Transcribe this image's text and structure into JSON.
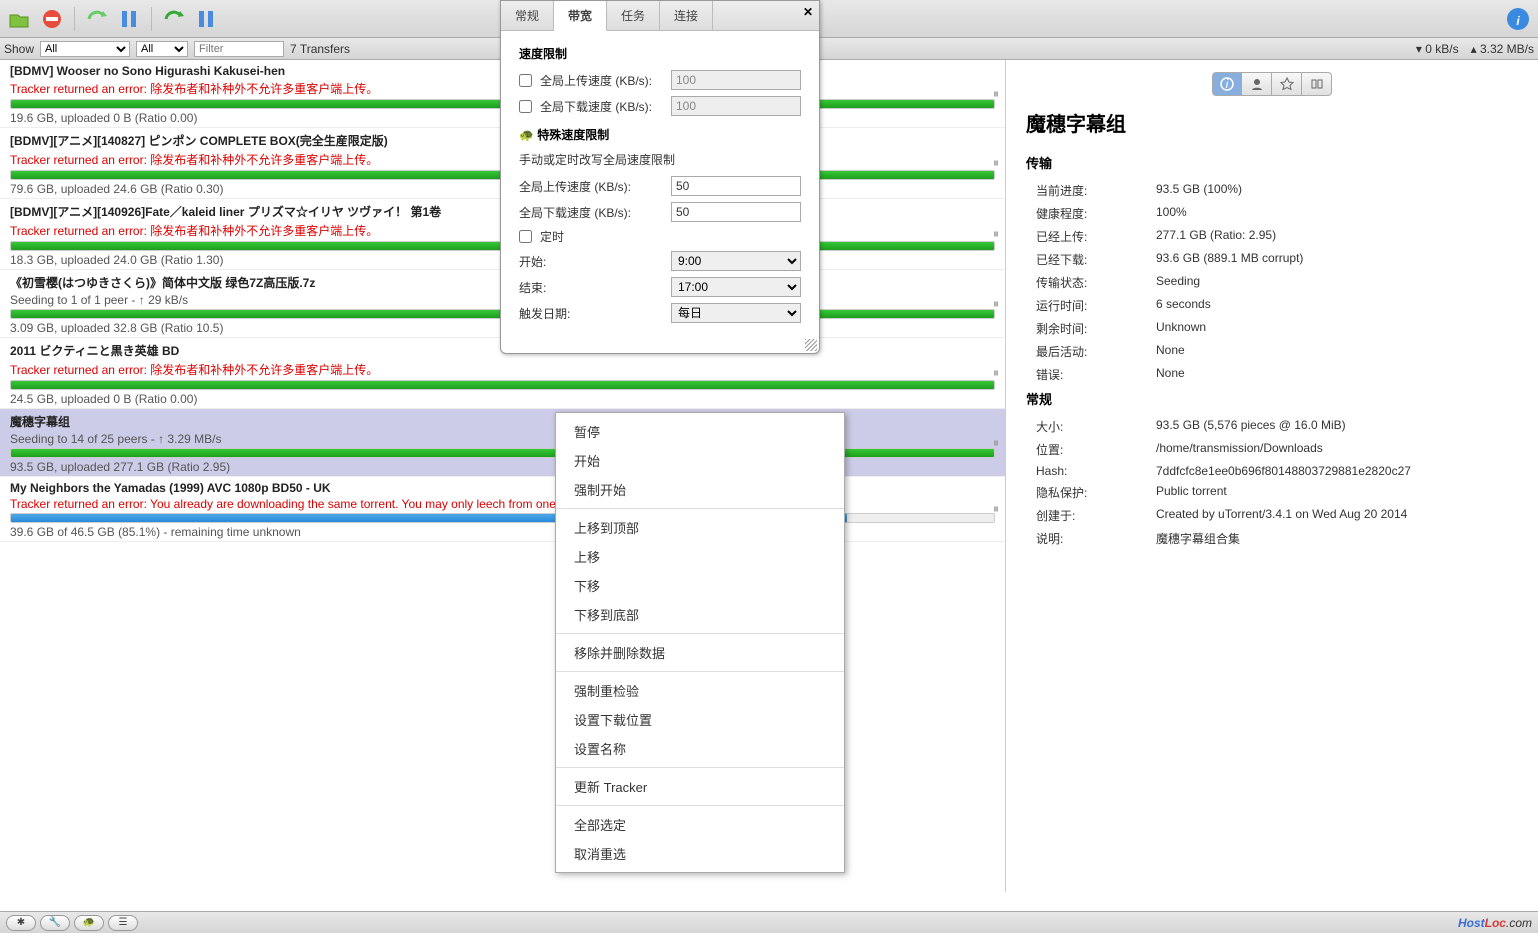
{
  "toolbar": {},
  "filter": {
    "show_label": "Show",
    "all1": "All",
    "all2": "All",
    "filter_placeholder": "Filter",
    "count": "7 Transfers",
    "down": "0 kB/s",
    "up": "3.32 MB/s"
  },
  "torrents": [
    {
      "title": "[BDMV] Wooser no Sono Higurashi Kakusei-hen",
      "err": "Tracker returned an error: 除发布者和补种外不允许多重客户端上传。",
      "pct": 100,
      "color": "green",
      "foot": "19.6 GB, uploaded 0 B (Ratio 0.00)",
      "status": ""
    },
    {
      "title": "[BDMV][アニメ][140827] ピンポン COMPLETE BOX(完全生産限定版)",
      "err": "Tracker returned an error: 除发布者和补种外不允许多重客户端上传。",
      "pct": 100,
      "color": "green",
      "foot": "79.6 GB, uploaded 24.6 GB (Ratio 0.30)",
      "status": ""
    },
    {
      "title": "[BDMV][アニメ][140926]Fate／kaleid liner プリズマ☆イリヤ ツヴァイ！ 第1卷",
      "err": "Tracker returned an error: 除发布者和补种外不允许多重客户端上传。",
      "pct": 100,
      "color": "green",
      "foot": "18.3 GB, uploaded 24.0 GB (Ratio 1.30)",
      "status": ""
    },
    {
      "title": "《初雪樱(はつゆきさくら)》简体中文版 绿色7Z高压版.7z",
      "err": "",
      "status": "Seeding to 1 of 1 peer - ↑ 29 kB/s",
      "pct": 100,
      "color": "green",
      "foot": "3.09 GB, uploaded 32.8 GB (Ratio 10.5)"
    },
    {
      "title": "2011 ビクティニと黒き英雄 BD",
      "err": "Tracker returned an error: 除发布者和补种外不允许多重客户端上传。",
      "pct": 100,
      "color": "green",
      "foot": "24.5 GB, uploaded 0 B (Ratio 0.00)",
      "status": ""
    },
    {
      "title": "魔穗字幕组",
      "err": "",
      "status": "Seeding to 14 of 25 peers - ↑ 3.29 MB/s",
      "pct": 100,
      "color": "green",
      "foot": "93.5 GB, uploaded 277.1 GB (Ratio 2.95)",
      "selected": true
    },
    {
      "title": "My Neighbors the Yamadas (1999) AVC 1080p BD50 - UK",
      "err": "Tracker returned an error: You already are downloading the same torrent. You may only leech from one location at a time.",
      "pct": 85,
      "color": "blue",
      "foot": "39.6 GB of 46.5 GB (85.1%) - remaining time unknown",
      "status": ""
    }
  ],
  "sidebar": {
    "title": "魔穗字幕组",
    "sections": {
      "transfer_label": "传输",
      "general_label": "常规"
    },
    "transfer": {
      "progress_k": "当前进度:",
      "progress_v": "93.5 GB (100%)",
      "health_k": "健康程度:",
      "health_v": "100%",
      "uploaded_k": "已经上传:",
      "uploaded_v": "277.1 GB (Ratio: 2.95)",
      "downloaded_k": "已经下载:",
      "downloaded_v": "93.6 GB (889.1 MB corrupt)",
      "state_k": "传输状态:",
      "state_v": "Seeding",
      "runtime_k": "运行时间:",
      "runtime_v": "6 seconds",
      "remain_k": "剩余时间:",
      "remain_v": "Unknown",
      "last_k": "最后活动:",
      "last_v": "None",
      "error_k": "错误:",
      "error_v": "None"
    },
    "general": {
      "size_k": "大小:",
      "size_v": "93.5 GB (5,576 pieces @ 16.0 MiB)",
      "loc_k": "位置:",
      "loc_v": "/home/transmission/Downloads",
      "hash_k": "Hash:",
      "hash_v": "7ddfcfc8e1ee0b696f80148803729881e2820c27",
      "priv_k": "隐私保护:",
      "priv_v": "Public torrent",
      "created_k": "创建于:",
      "created_v": "Created by uTorrent/3.4.1 on Wed Aug 20 2014",
      "desc_k": "说明:",
      "desc_v": "魔穗字幕组合集"
    }
  },
  "dialog": {
    "tabs": {
      "general": "常规",
      "bw": "带宽",
      "task": "任务",
      "conn": "连接"
    },
    "h1": "速度限制",
    "gup_label": "全局上传速度 (KB/s):",
    "gup_val": "100",
    "gdown_label": "全局下载速度 (KB/s):",
    "gdown_val": "100",
    "h2": "特殊速度限制",
    "sub": "手动或定时改写全局速度限制",
    "sup_label": "全局上传速度 (KB/s):",
    "sup_val": "50",
    "sdown_label": "全局下载速度 (KB/s):",
    "sdown_val": "50",
    "sched_label": "定时",
    "start_label": "开始:",
    "start_val": "9:00",
    "end_label": "结束:",
    "end_val": "17:00",
    "trig_label": "触发日期:",
    "trig_val": "每日"
  },
  "context": {
    "items1": [
      "暂停",
      "开始",
      "强制开始"
    ],
    "items2": [
      "上移到顶部",
      "上移",
      "下移",
      "下移到底部"
    ],
    "items3": [
      "移除并删除数据"
    ],
    "items4": [
      "强制重检验",
      "设置下载位置",
      "设置名称"
    ],
    "items5": [
      "更新 Tracker"
    ],
    "items6": [
      "全部选定",
      "取消重选"
    ]
  },
  "brand": {
    "h": "Host",
    "l": "Loc",
    "c": ".com"
  }
}
